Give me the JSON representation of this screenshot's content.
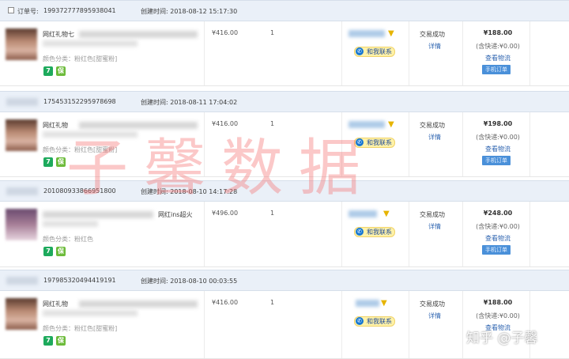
{
  "orders": [
    {
      "order_label": "订单号:",
      "order_no": "199372777895938041",
      "created": "创建时间: 2018-08-12 15:17:30",
      "product_title": "网红礼物七",
      "product_attr": "颜色分类：粉红色[甜蜜粉]",
      "price": "¥416.00",
      "qty": "1",
      "chat_label": "和我联系",
      "status": "交易成功",
      "detail": "详情",
      "total": "¥188.00",
      "shipping": "(含快递:¥0.00)",
      "logistics": "查看物流",
      "one_click": "手机订单"
    },
    {
      "order_label": "",
      "order_no": "175453152295978698",
      "created": "创建时间: 2018-08-11 17:04:02",
      "product_title": "网红礼物",
      "product_attr": "颜色分类：粉红色[甜蜜粉]",
      "price": "¥416.00",
      "qty": "1",
      "chat_label": "和我联系",
      "status": "交易成功",
      "detail": "详情",
      "total": "¥198.00",
      "shipping": "(含快递:¥0.00)",
      "logistics": "查看物流",
      "one_click": "手机订单"
    },
    {
      "order_label": "",
      "order_no": "201080933866951800",
      "created": "创建时间: 2018-08-10 14:17:28",
      "product_title": "网红ins超火",
      "product_attr": "颜色分类：粉红色",
      "price": "¥496.00",
      "qty": "1",
      "chat_label": "和我联系",
      "status": "交易成功",
      "detail": "详情",
      "total": "¥248.00",
      "shipping": "(含快递:¥0.00)",
      "logistics": "查看物流",
      "one_click": "手机订单"
    },
    {
      "order_label": "",
      "order_no": "197985320494419191",
      "created": "创建时间: 2018-08-10 00:03:55",
      "product_title": "网红礼物",
      "product_attr": "颜色分类：粉红色[甜蜜粉]",
      "price": "¥416.00",
      "qty": "1",
      "chat_label": "和我联系",
      "status": "交易成功",
      "detail": "详情",
      "total": "¥188.00",
      "shipping": "(含快递:¥0.00)",
      "logistics": "查看物流",
      "one_click": "手机订单"
    }
  ],
  "badges": {
    "seven_day": "7",
    "guarantee": "保"
  },
  "watermark": {
    "main": "子馨数据",
    "source": "知乎 @子馨"
  },
  "icons": {
    "chat": "chat-bubble-icon",
    "filter": "funnel-icon"
  },
  "colors": {
    "header_bg": "#eaf0f8",
    "link": "#2e64b0",
    "badge_green": "#1daa5c",
    "chat_bg": "#fff2a8"
  }
}
